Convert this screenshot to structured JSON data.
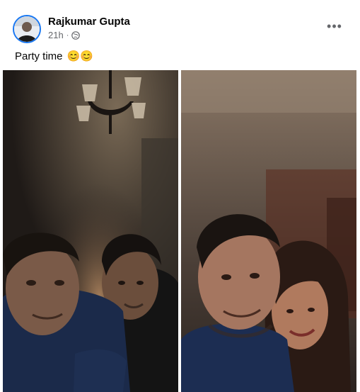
{
  "post": {
    "author": "Rajkumar Gupta",
    "time": "21h",
    "separator": "·",
    "privacy_icon": "globe-icon",
    "more_icon": "more-options-icon",
    "more_label": "•••",
    "caption": "Party time",
    "caption_emoji": "😊😊"
  },
  "photos": [
    {
      "name": "photo-1",
      "description_icon": "selfie-photo"
    },
    {
      "name": "photo-2",
      "description_icon": "selfie-photo"
    }
  ],
  "colors": {
    "author_text": "#050505",
    "meta_text": "#65676b",
    "avatar_ring": "#1877f2"
  }
}
